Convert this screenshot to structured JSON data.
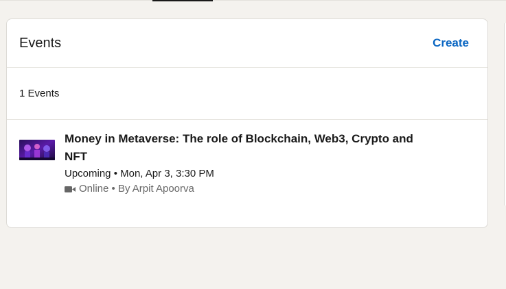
{
  "events_card": {
    "title": "Events",
    "create_label": "Create",
    "count_label": "1 Events",
    "items": [
      {
        "title": "Money in Metaverse: The role of Blockchain, Web3, Crypto and NFT",
        "time": "Upcoming • Mon, Apr 3, 3:30 PM",
        "meta": "Online • By Arpit Apoorva",
        "format_icon": "video-camera-icon",
        "thumbnail": "event-thumbnail-image"
      }
    ]
  },
  "colors": {
    "accent": "#0a66c2",
    "page_background": "#f4f2ee",
    "card_background": "#ffffff",
    "secondary_text": "#666666"
  }
}
